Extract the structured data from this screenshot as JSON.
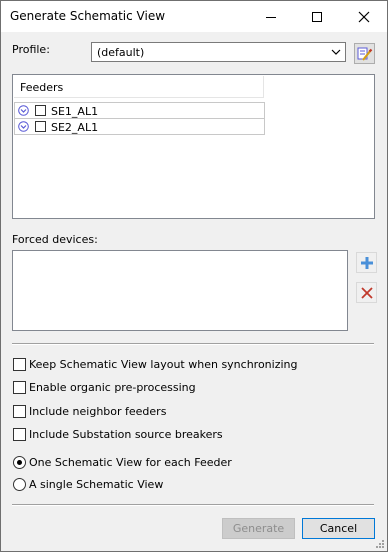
{
  "window": {
    "title": "Generate Schematic View"
  },
  "profile": {
    "label": "Profile:",
    "value": "(default)"
  },
  "feeders": {
    "header": "Feeders",
    "rows": [
      {
        "name": "SE1_AL1"
      },
      {
        "name": "SE2_AL1"
      }
    ]
  },
  "forced_devices": {
    "label": "Forced devices:"
  },
  "options": [
    {
      "label": "Keep Schematic View layout when synchronizing",
      "checked": false
    },
    {
      "label": "Enable organic pre-processing",
      "checked": false
    },
    {
      "label": "Include neighbor feeders",
      "checked": false
    },
    {
      "label": "Include Substation source breakers",
      "checked": false
    }
  ],
  "mode": [
    {
      "label": "One Schematic View for each Feeder",
      "selected": true
    },
    {
      "label": "A single Schematic View",
      "selected": false
    }
  ],
  "buttons": {
    "generate": "Generate",
    "cancel": "Cancel"
  },
  "colors": {
    "accent": "#0078d7",
    "add_icon": "#4a90d9",
    "delete_icon": "#c0392b",
    "expand_icon": "#5b5bd6"
  }
}
